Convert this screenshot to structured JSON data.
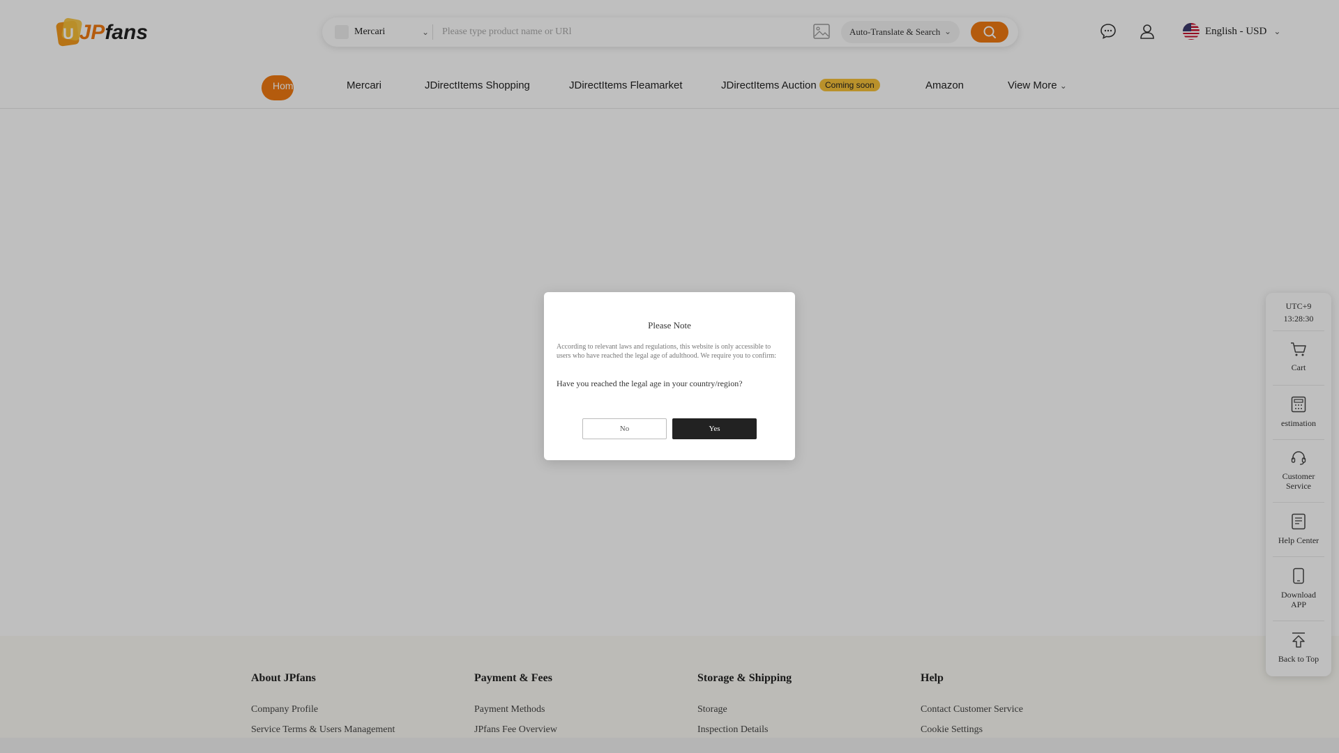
{
  "brand": {
    "logo_text_a": "JP",
    "logo_text_b": "fans",
    "logo_badge": "U"
  },
  "search": {
    "site_selected": "Mercari",
    "placeholder": "Please type product name or URl",
    "translate_option": "Auto-Translate & Search"
  },
  "header": {
    "language": "English - USD"
  },
  "nav": {
    "home": "Home",
    "items": [
      "Mercari",
      "JDirectItems Shopping",
      "JDirectItems Fleamarket",
      "JDirectItems Auction",
      "Amazon",
      "View More"
    ],
    "auction_badge": "Coming soon"
  },
  "sidebar": {
    "timezone": "UTC+9",
    "time": "13:28:30",
    "items": [
      "Cart",
      "estimation",
      "Customer Service",
      "Help Center",
      "Download APP",
      "Back to Top"
    ]
  },
  "footer": {
    "columns": [
      {
        "title": "About JPfans",
        "links": [
          "Company Profile",
          "Service Terms & Users Management"
        ]
      },
      {
        "title": "Payment & Fees",
        "links": [
          "Payment Methods",
          "JPfans Fee Overview"
        ]
      },
      {
        "title": "Storage & Shipping",
        "links": [
          "Storage",
          "Inspection Details"
        ]
      },
      {
        "title": "Help",
        "links": [
          "Contact Customer Service",
          "Cookie Settings"
        ]
      }
    ]
  },
  "modal": {
    "title": "Please Note",
    "text": "According to relevant laws and regulations, this website is only accessible to users who have reached the legal age of adulthood. We require you to confirm:",
    "question": "Have you reached the legal age in your country/region?",
    "no_label": "No",
    "yes_label": "Yes"
  },
  "colors": {
    "accent": "#f07a12",
    "badge": "#f7c23a",
    "overlay": "rgba(0,0,0,0.25)"
  }
}
